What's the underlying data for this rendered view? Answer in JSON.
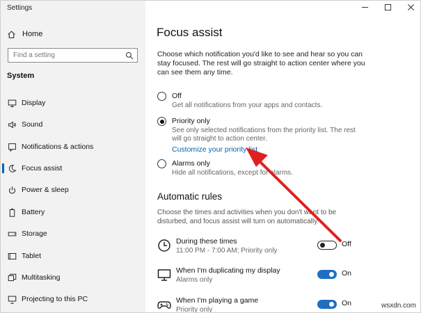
{
  "app": {
    "title": "Settings"
  },
  "sidebar": {
    "home_label": "Home",
    "search_placeholder": "Find a setting",
    "section_title": "System",
    "items": [
      {
        "label": "Display",
        "icon": "monitor-icon"
      },
      {
        "label": "Sound",
        "icon": "speaker-icon"
      },
      {
        "label": "Notifications & actions",
        "icon": "notification-icon"
      },
      {
        "label": "Focus assist",
        "icon": "moon-icon",
        "active": true
      },
      {
        "label": "Power & sleep",
        "icon": "power-icon"
      },
      {
        "label": "Battery",
        "icon": "battery-icon"
      },
      {
        "label": "Storage",
        "icon": "storage-icon"
      },
      {
        "label": "Tablet",
        "icon": "tablet-icon"
      },
      {
        "label": "Multitasking",
        "icon": "multitasking-icon"
      },
      {
        "label": "Projecting to this PC",
        "icon": "project-icon"
      }
    ]
  },
  "main": {
    "title": "Focus assist",
    "description": "Choose which notification you'd like to see and hear so you can stay focused. The rest will go straight to action center where you can see them any time.",
    "options": [
      {
        "label": "Off",
        "sub": "Get all notifications from your apps and contacts.",
        "checked": false
      },
      {
        "label": "Priority only",
        "sub": "See only selected notifications from the priority list. The rest will go straight to action center.",
        "link": "Customize your priority list",
        "checked": true
      },
      {
        "label": "Alarms only",
        "sub": "Hide all notifications, except for alarms.",
        "checked": false
      }
    ],
    "automatic_rules": {
      "heading": "Automatic rules",
      "description": "Choose the times and activities when you don't want to be disturbed, and focus assist will turn on automatically.",
      "rules": [
        {
          "title": "During these times",
          "sub": "11:00 PM - 7:00 AM; Priority only",
          "state": "Off",
          "on": false,
          "icon": "clock-icon"
        },
        {
          "title": "When I'm duplicating my display",
          "sub": "Alarms only",
          "state": "On",
          "on": true,
          "icon": "monitor-icon"
        },
        {
          "title": "When I'm playing a game",
          "sub": "Priority only",
          "state": "On",
          "on": true,
          "icon": "gamepad-icon"
        }
      ]
    }
  },
  "watermark": "wsxdn.com",
  "colors": {
    "accent": "#0063b1",
    "toggle_on": "#1f6fc0",
    "annotation_arrow": "#e02020",
    "sidebar_bg": "#f2f2f2"
  }
}
